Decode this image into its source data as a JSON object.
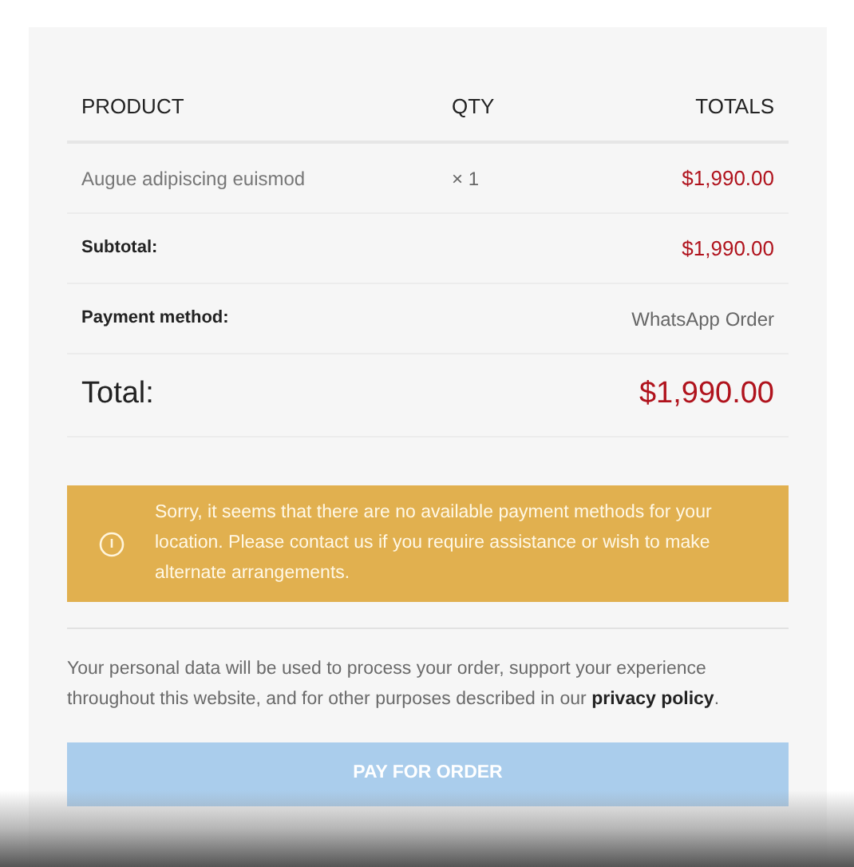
{
  "table": {
    "columns": [
      "PRODUCT",
      "QTY",
      "TOTALS"
    ],
    "rows": [
      {
        "kind": "item",
        "product": "Augue adipiscing euismod",
        "qty": "× 1",
        "total": "$1,990.00"
      },
      {
        "kind": "subtotal",
        "label": "Subtotal:",
        "value": "$1,990.00"
      },
      {
        "kind": "method",
        "label": "Payment method:",
        "value": "WhatsApp Order"
      },
      {
        "kind": "total",
        "label": "Total:",
        "value": "$1,990.00"
      }
    ]
  },
  "notice": {
    "text": "Sorry, it seems that there are no available payment methods for your location. Please contact us if you require assistance or wish to make alternate arrangements."
  },
  "privacy": {
    "text": "Your personal data will be used to process your order, support your experience throughout this website, and for other purposes described in our",
    "link": "privacy policy",
    "after": "."
  },
  "button": {
    "label": "PAY FOR ORDER",
    "disabled": true
  }
}
